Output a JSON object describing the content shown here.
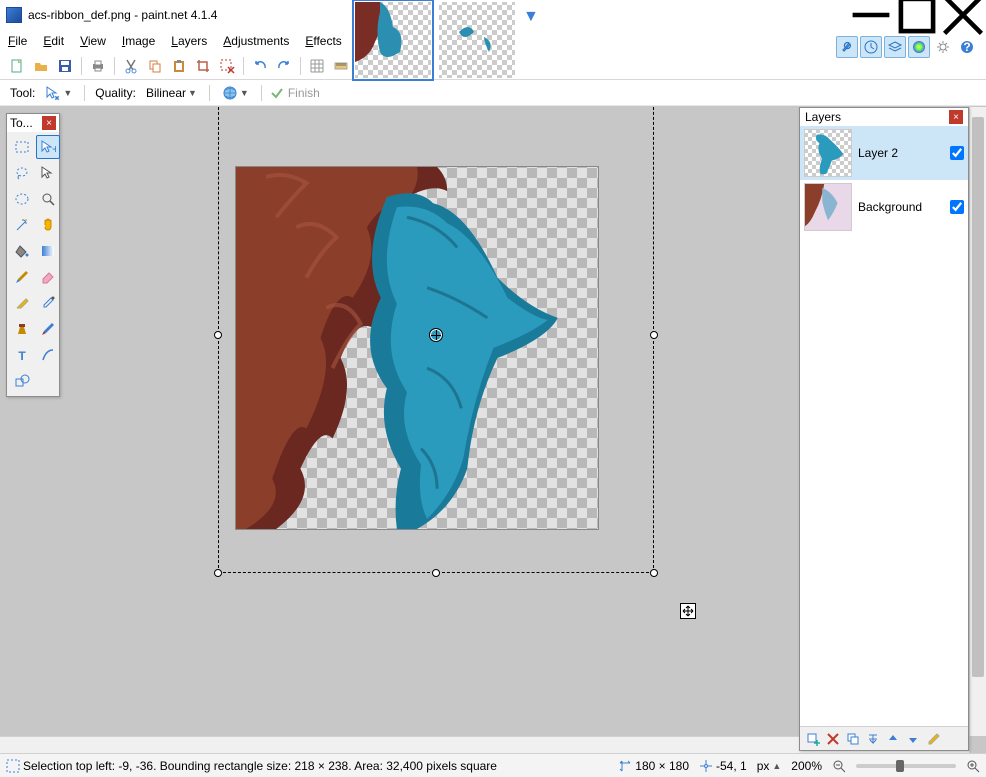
{
  "title": "acs-ribbon_def.png - paint.net 4.1.4",
  "menu": [
    "File",
    "Edit",
    "View",
    "Image",
    "Layers",
    "Adjustments",
    "Effects"
  ],
  "subtoolbar": {
    "tool_label": "Tool:",
    "quality_label": "Quality:",
    "quality_value": "Bilinear",
    "finish_label": "Finish"
  },
  "tools_window": {
    "title": "To..."
  },
  "layers_window": {
    "title": "Layers",
    "items": [
      {
        "name": "Layer 2",
        "visible": true,
        "selected": true
      },
      {
        "name": "Background",
        "visible": true,
        "selected": false
      }
    ]
  },
  "status": {
    "selection": "Selection top left: -9, -36. Bounding rectangle size: 218 × 238. Area: 32,400 pixels square",
    "size": "180 × 180",
    "cursor": "-54, 1",
    "units": "px",
    "zoom": "200%"
  }
}
